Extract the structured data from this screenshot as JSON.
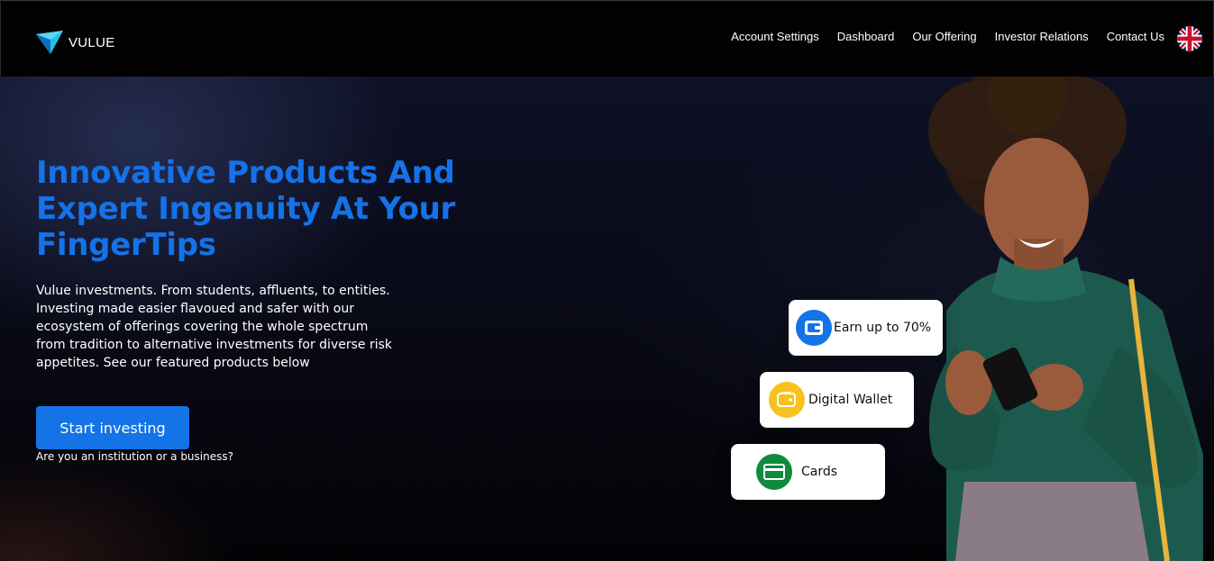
{
  "brand": {
    "name": "VULUE",
    "logo_icon": "triangle-logo-icon"
  },
  "nav": {
    "items": [
      {
        "label": "Account Settings"
      },
      {
        "label": "Dashboard"
      },
      {
        "label": "Our Offering"
      },
      {
        "label": "Investor Relations"
      },
      {
        "label": "Contact Us"
      }
    ],
    "language_icon": "uk-flag-icon"
  },
  "hero": {
    "title": "Innovative Products And Expert Ingenuity At Your FingerTips",
    "description": "Vulue investments. From students, affluents, to entities. Investing made easier flavoued and safer with our ecosystem of offerings covering the whole spectrum from tradition to alternative investments for diverse risk appetites. See our featured products below",
    "cta_label": "Start investing",
    "sub_cta": "Are you an institution or a business?"
  },
  "features": [
    {
      "label": "Earn up to 70%",
      "icon": "wallet-icon",
      "color": "#1473e6"
    },
    {
      "label": "Digital Wallet",
      "icon": "digital-wallet-icon",
      "color": "#f7c21e"
    },
    {
      "label": "Cards",
      "icon": "card-icon",
      "color": "#0f8a3e"
    }
  ],
  "colors": {
    "accent": "#1473e6",
    "title": "#1572e8",
    "header_bg": "#020203"
  }
}
